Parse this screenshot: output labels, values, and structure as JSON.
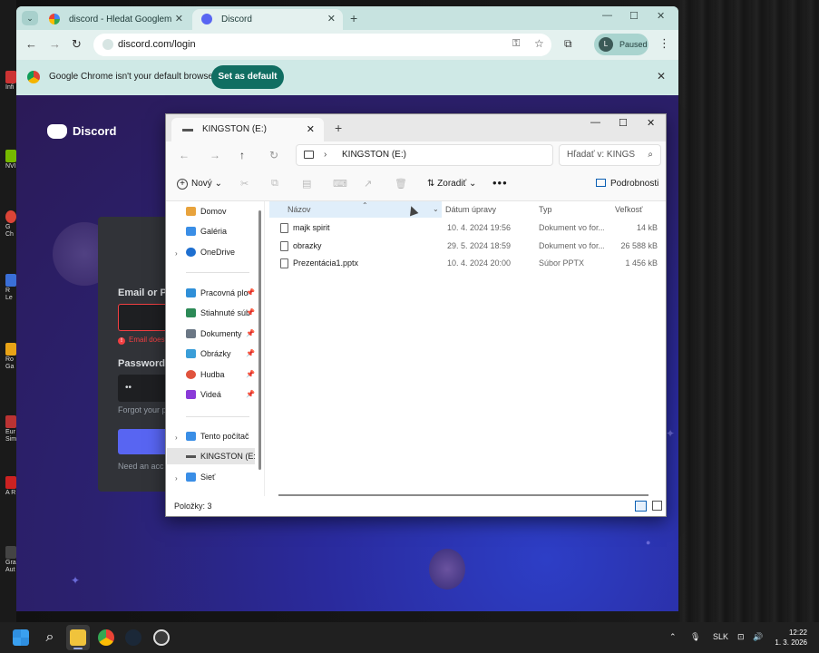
{
  "browser": {
    "tabs": [
      {
        "label": "discord - Hledat Googlem"
      },
      {
        "label": "Discord"
      }
    ],
    "url": "discord.com/login",
    "profile": {
      "initial": "L",
      "status": "Paused"
    },
    "infobar": {
      "message": "Google Chrome isn't your default browser",
      "button": "Set as default"
    }
  },
  "discord": {
    "brand": "Discord",
    "email_label": "Email or Ph",
    "email_error": "Email does",
    "password_label": "Password",
    "password_value": "••",
    "forgot": "Forgot your p",
    "need_account": "Need an acc"
  },
  "desktop_icons": [
    {
      "label": "Infi"
    },
    {
      "label": "NVI"
    },
    {
      "label": "G Ch"
    },
    {
      "label": "R Le"
    },
    {
      "label": "Ro Ga"
    },
    {
      "label": "Eur Sim"
    },
    {
      "label": "A R"
    },
    {
      "label": "Gra Aut"
    }
  ],
  "explorer": {
    "tab_title": "KINGSTON (E:)",
    "path": "KINGSTON (E:)",
    "search_placeholder": "Hľadať v: KINGS",
    "toolbar": {
      "new": "Nový",
      "sort": "Zoradiť",
      "details": "Podrobnosti"
    },
    "sidebar": {
      "top": [
        "Domov",
        "Galéria",
        "OneDrive"
      ],
      "pinned": [
        "Pracovná plo",
        "Stiahnuté súb",
        "Dokumenty",
        "Obrázky",
        "Hudba",
        "Videá"
      ],
      "bottom": [
        "Tento počítač",
        "KINGSTON (E:)",
        "Sieť"
      ]
    },
    "columns": {
      "name": "Názov",
      "date": "Dátum úpravy",
      "type": "Typ",
      "size": "Veľkosť"
    },
    "files": [
      {
        "name": "majk spirit",
        "date": "10. 4. 2024 19:56",
        "type": "Dokument vo for...",
        "size": "14 kB"
      },
      {
        "name": "obrazky",
        "date": "29. 5. 2024 18:59",
        "type": "Dokument vo for...",
        "size": "26 588 kB"
      },
      {
        "name": "Prezentácia1.pptx",
        "date": "10. 4. 2024 20:00",
        "type": "Súbor PPTX",
        "size": "1 456 kB"
      }
    ],
    "status": "Položky: 3"
  },
  "taskbar": {
    "lang": "SLK",
    "time": "12:22",
    "date": "1. 3. 2026"
  },
  "colors": {
    "chrome_frame": "#c7e3e0",
    "set_default_btn": "#106e62",
    "discord_blurple": "#5865f2",
    "discord_card": "#313338",
    "error_red": "#f23f42"
  }
}
